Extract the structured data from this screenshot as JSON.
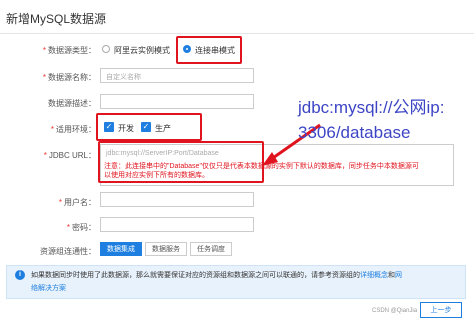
{
  "dialog": {
    "title": "新增MySQL数据源"
  },
  "form": {
    "source_type": {
      "label": "数据源类型：",
      "options": [
        {
          "label": "阿里云实例模式",
          "selected": false
        },
        {
          "label": "连接串模式",
          "selected": true
        }
      ]
    },
    "source_name": {
      "label": "数据源名称：",
      "placeholder": "自定义名称"
    },
    "source_desc": {
      "label": "数据源描述："
    },
    "environment": {
      "label": "适用环境：",
      "options": [
        {
          "label": "开发",
          "checked": true
        },
        {
          "label": "生产",
          "checked": true
        }
      ]
    },
    "jdbc_url": {
      "label": "JDBC URL：",
      "placeholder": "jdbc:mysql://ServerIP:Port/Database",
      "note_line1": "注意：此连接串中的\"Database\"仅仅只是代表本数据源的实例下默认的数据库，同步任务中本数据源可",
      "note_line2": "以使用对应实例下所有的数据库。"
    },
    "username": {
      "label": "用户名："
    },
    "password": {
      "label": "密码："
    },
    "connectivity": {
      "label": "资源组连通性：",
      "tabs": [
        "数据集成",
        "数据服务",
        "任务调度"
      ]
    }
  },
  "info": {
    "icon": "info-icon",
    "text": "如果数据同步时使用了此数据源，那么就需要保证对应的资源组和数据源之间可以联通的，请参考资源组的",
    "link1": "详细概念",
    "and": "和",
    "link2": "网",
    "text2": "络解决方案"
  },
  "annotation": {
    "line1": "jdbc:mysql://公网ip:",
    "line2": "3306/database"
  },
  "footer": {
    "next_label": "上一步"
  },
  "watermark": "CSDN @QianJia",
  "colors": {
    "accent": "#1e7fe0",
    "highlight": "#e0141e",
    "annotation": "#3d45c5"
  }
}
